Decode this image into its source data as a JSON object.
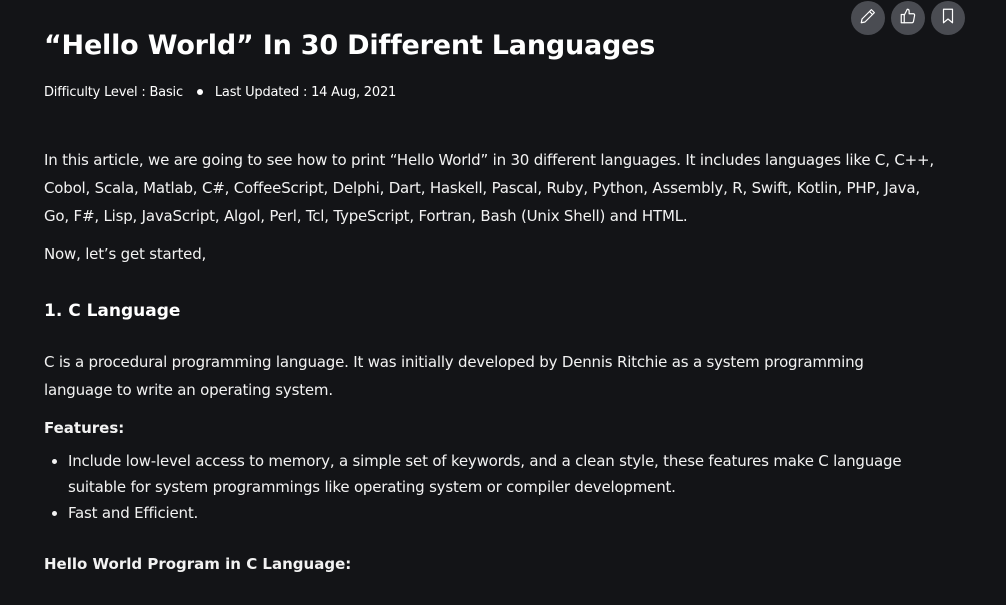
{
  "toolbar": {
    "buttons": [
      {
        "icon": "pencil-icon",
        "name": "edit-button"
      },
      {
        "icon": "thumbs-up-icon",
        "name": "like-button"
      },
      {
        "icon": "bookmark-icon",
        "name": "bookmark-button"
      }
    ]
  },
  "article": {
    "title": "“Hello World” In 30 Different Languages",
    "difficulty": "Difficulty Level : Basic",
    "last_updated": "Last Updated : 14 Aug, 2021",
    "intro": "In this article, we are going to see how to print “Hello World” in 30 different languages. It includes languages like C, C++, Cobol, Scala, Matlab, C#, CoffeeScript, Delphi, Dart, Haskell, Pascal, Ruby, Python, Assembly, R, Swift, Kotlin, PHP, Java, Go, F#, Lisp, JavaScript, Algol, Perl, Tcl, TypeScript, Fortran, Bash (Unix Shell) and HTML.",
    "lets_start": "Now, let’s get started,",
    "section1": {
      "heading": "1. C Language",
      "description": "C is a procedural programming language. It was initially developed by Dennis Ritchie as a system programming language to write an operating system.",
      "features_label": "Features:",
      "features": [
        "Include low-level access to memory, a simple set of keywords, and a clean style, these features make C language suitable for system programmings like operating system or compiler development.",
        "Fast and Efficient."
      ],
      "program_label": "Hello World Program in C Language:"
    }
  },
  "colors": {
    "background": "#131417",
    "text": "#f2f2f2",
    "button_bg": "#4a4c52"
  }
}
